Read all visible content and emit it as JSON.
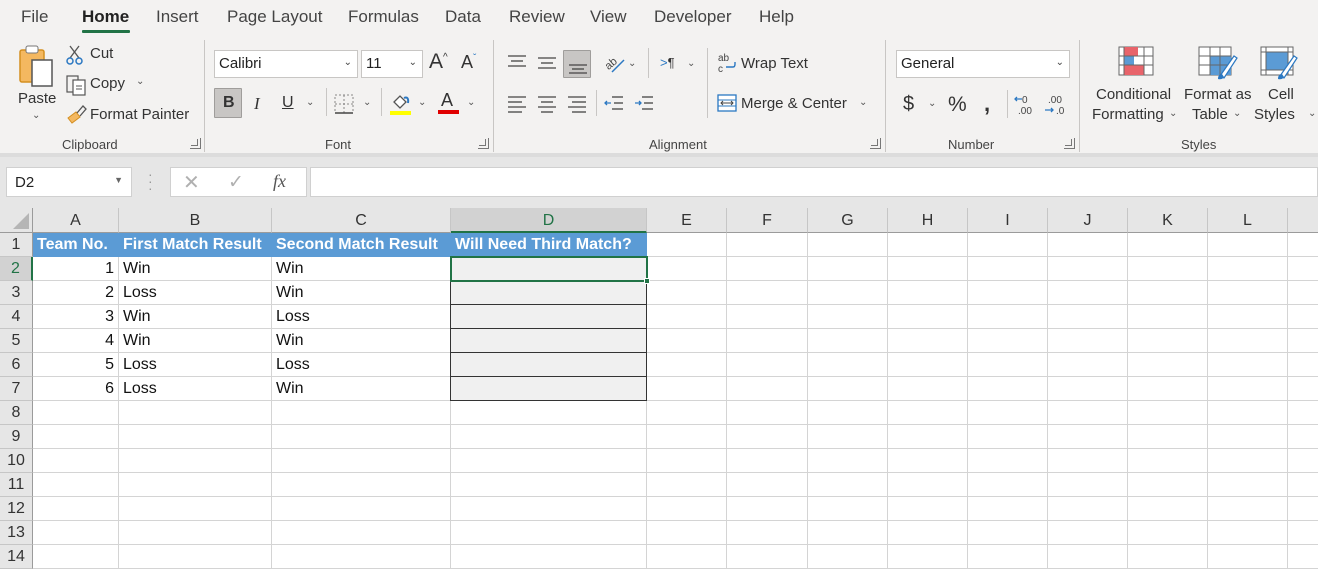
{
  "menu": {
    "tabs": [
      {
        "label": "File",
        "active": false
      },
      {
        "label": "Home",
        "active": true
      },
      {
        "label": "Insert",
        "active": false
      },
      {
        "label": "Page Layout",
        "active": false
      },
      {
        "label": "Formulas",
        "active": false
      },
      {
        "label": "Data",
        "active": false
      },
      {
        "label": "Review",
        "active": false
      },
      {
        "label": "View",
        "active": false
      },
      {
        "label": "Developer",
        "active": false
      },
      {
        "label": "Help",
        "active": false
      }
    ]
  },
  "ribbon": {
    "clipboard": {
      "group_label": "Clipboard",
      "paste": "Paste",
      "cut": "Cut",
      "copy": "Copy",
      "format_painter": "Format Painter"
    },
    "font": {
      "group_label": "Font",
      "font_name": "Calibri",
      "font_size": "11",
      "bold": "B",
      "italic": "I",
      "underline": "U",
      "grow": "A",
      "shrink": "A",
      "font_color_letter": "A",
      "highlight_color": "#ffff00",
      "font_color": "#e00000"
    },
    "alignment": {
      "group_label": "Alignment",
      "wrap_text": "Wrap Text",
      "merge_center": "Merge & Center",
      "indent_glyph": ">¶"
    },
    "number": {
      "group_label": "Number",
      "format": "General",
      "currency": "$",
      "percent": "%",
      "comma": "❩"
    },
    "styles": {
      "group_label": "Styles",
      "conditional_formatting": [
        "Conditional",
        "Formatting"
      ],
      "format_as_table": [
        "Format as",
        "Table"
      ],
      "cell_styles": [
        "Cell",
        "Styles"
      ]
    }
  },
  "formula_bar": {
    "name_box": "D2",
    "fx": "fx",
    "formula": ""
  },
  "sheet": {
    "columns": [
      "A",
      "B",
      "C",
      "D",
      "E",
      "F",
      "G",
      "H",
      "I",
      "J",
      "K",
      "L"
    ],
    "rows": [
      "1",
      "2",
      "3",
      "4",
      "5",
      "6",
      "7",
      "8",
      "9",
      "10",
      "11",
      "12",
      "13",
      "14"
    ],
    "selected_cell": "D2",
    "header_fill": "#5b9bd5",
    "accent": "#217346",
    "headers": [
      "Team No.",
      "First Match Result",
      "Second Match Result",
      "Will Need Third Match?"
    ],
    "data": [
      [
        "1",
        "Win",
        "Win",
        ""
      ],
      [
        "2",
        "Loss",
        "Win",
        ""
      ],
      [
        "3",
        "Win",
        "Loss",
        ""
      ],
      [
        "4",
        "Win",
        "Win",
        ""
      ],
      [
        "5",
        "Loss",
        "Loss",
        ""
      ],
      [
        "6",
        "Loss",
        "Win",
        ""
      ]
    ]
  }
}
